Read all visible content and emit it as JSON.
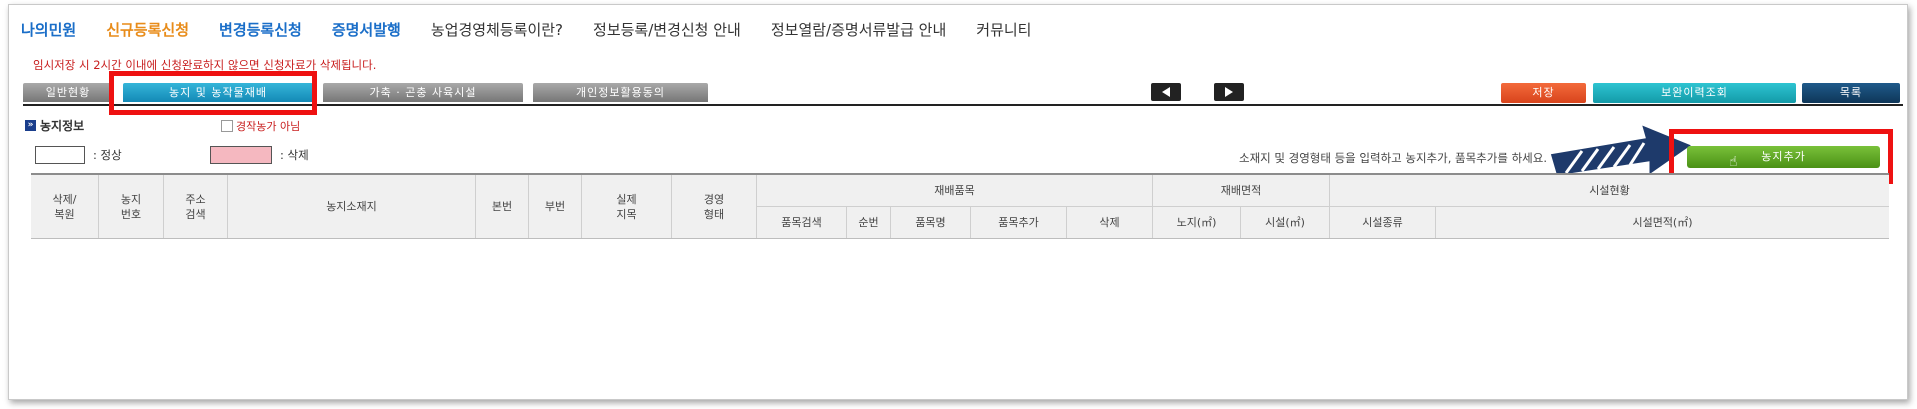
{
  "topnav": [
    {
      "label": "나의민원",
      "color": "#1a6ec8"
    },
    {
      "label": "신규등록신청",
      "color": "#e88c1a"
    },
    {
      "label": "변경등록신청",
      "color": "#1a6ec8"
    },
    {
      "label": "증명서발행",
      "color": "#1a6ec8"
    },
    {
      "label": "농업경영체등록이란?",
      "color": "#333333"
    },
    {
      "label": "정보등록/변경신청 안내",
      "color": "#333333"
    },
    {
      "label": "정보열람/증명서류발급 안내",
      "color": "#333333"
    },
    {
      "label": "커뮤니티",
      "color": "#333333"
    }
  ],
  "notice": "임시저장 시 2시간 이내에 신청완료하지 않으면 신청자료가 삭제됩니다.",
  "tabs": [
    "일반현황",
    "농지 및 농작물재배",
    "가축 · 곤충 사육시설",
    "개인정보활용동의"
  ],
  "actions": {
    "save": "저장",
    "history": "보완이력조회",
    "list": "목록"
  },
  "section": {
    "title": "농지정보",
    "checkbox_label": "경작농가 아님"
  },
  "legend": {
    "normal": ": 정상",
    "deleted": ": 삭제"
  },
  "hint": "소재지 및 경영형태 등을 입력하고 농지추가, 품목추가를 하세요.",
  "add_button": "농지추가",
  "table": {
    "headers": [
      "삭제/\n복원",
      "농지\n번호",
      "주소\n검색",
      "농지소재지",
      "본번",
      "부번",
      "실제\n지목",
      "경영\n형태"
    ],
    "groups": [
      "재배품목",
      "재배면적",
      "시설현황"
    ],
    "subheaders": [
      "품목검색",
      "순번",
      "품목명",
      "품목추가",
      "삭제",
      "노지(㎡)",
      "시설(㎡)",
      "시설종류",
      "시설면적(㎡)"
    ]
  },
  "colors": {
    "accent_tab": "#1a9fcc",
    "save_btn": "#e8582a",
    "history_btn": "#1fb3c2",
    "list_btn": "#15456f",
    "add_btn": "#5ea623",
    "highlight": "#ee1111"
  }
}
